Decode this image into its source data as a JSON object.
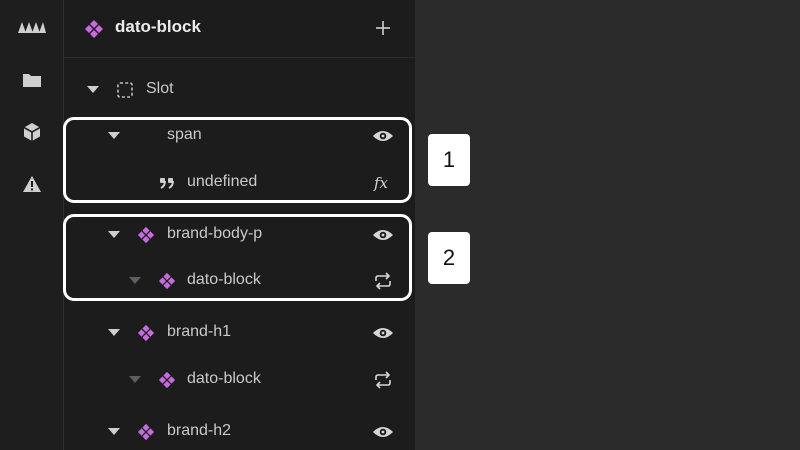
{
  "rail": {
    "items": [
      {
        "icon": "trees-icon"
      },
      {
        "icon": "folder-icon"
      },
      {
        "icon": "package-icon"
      },
      {
        "icon": "warning-icon"
      }
    ]
  },
  "panel": {
    "title": "dato-block",
    "add_label": "+"
  },
  "tree": [
    {
      "label": "Slot",
      "icon": "slot-icon",
      "action": null
    },
    {
      "label": "span",
      "icon": null,
      "action": "eye-icon"
    },
    {
      "label": "undefined",
      "icon": "quote-icon",
      "action": "function-icon"
    },
    {
      "label": "brand-body-p",
      "icon": "component-icon",
      "action": "eye-icon"
    },
    {
      "label": "dato-block",
      "icon": "component-icon",
      "action": "repeat-icon"
    },
    {
      "label": "brand-h1",
      "icon": "component-icon",
      "action": "eye-icon"
    },
    {
      "label": "dato-block",
      "icon": "component-icon",
      "action": "repeat-icon"
    },
    {
      "label": "brand-h2",
      "icon": "component-icon",
      "action": "eye-icon"
    }
  ],
  "callouts": [
    {
      "label": "1"
    },
    {
      "label": "2"
    }
  ],
  "colors": {
    "accent": "#c86be0",
    "panel": "#1c1c1c",
    "rail": "#1e1e1e",
    "canvas": "#2b2b2b"
  }
}
